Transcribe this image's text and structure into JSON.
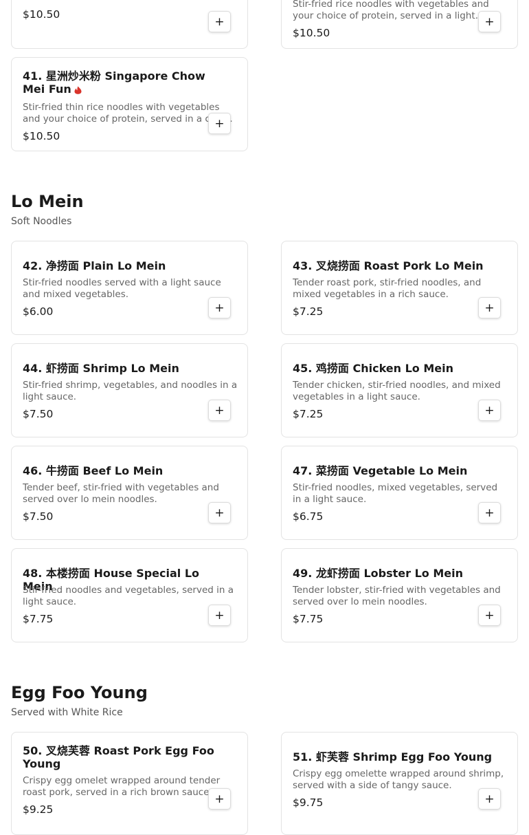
{
  "colors": {
    "spicy": "#d9342b",
    "card_border": "#e3e3e3",
    "description": "#666666"
  },
  "add_button_label": "+",
  "top_items": [
    {
      "price": "$10.50"
    },
    {
      "description": "Stir-fried rice noodles with vegetables and your choice of protein, served in a light sauce.",
      "price": "$10.50"
    },
    {
      "title": "41. 星洲炒米粉 Singapore Chow Mei Fun",
      "spicy": true,
      "spicy_icon": "chili-flame-icon",
      "description": "Stir-fried thin rice noodles with vegetables and your choice of protein, served in a curry sauce.",
      "price": "$10.50"
    }
  ],
  "sections": [
    {
      "title": "Lo Mein",
      "subtitle": "Soft Noodles",
      "items": [
        {
          "title": "42. 净捞面 Plain Lo Mein",
          "description": "Stir-fried noodles served with a light sauce and mixed vegetables.",
          "price": "$6.00"
        },
        {
          "title": "43. 叉烧捞面 Roast Pork Lo Mein",
          "description": "Tender roast pork, stir-fried noodles, and mixed vegetables in a rich sauce.",
          "price": "$7.25"
        },
        {
          "title": "44. 虾捞面 Shrimp Lo Mein",
          "description": "Stir-fried shrimp, vegetables, and noodles in a light sauce.",
          "price": "$7.50"
        },
        {
          "title": "45. 鸡捞面 Chicken Lo Mein",
          "description": "Tender chicken, stir-fried noodles, and mixed vegetables in a light sauce.",
          "price": "$7.25"
        },
        {
          "title": "46. 牛捞面 Beef Lo Mein",
          "description": "Tender beef, stir-fried with vegetables and served over lo mein noodles.",
          "price": "$7.50"
        },
        {
          "title": "47. 菜捞面 Vegetable Lo Mein",
          "description": "Stir-fried noodles, mixed vegetables, served in a light sauce.",
          "price": "$6.75"
        },
        {
          "title": "48. 本楼捞面 House Special Lo Mein",
          "description": "Stir-fried noodles and vegetables, served in a light sauce.",
          "price": "$7.75"
        },
        {
          "title": "49. 龙虾捞面 Lobster Lo Mein",
          "description": "Tender lobster, stir-fried with vegetables and served over lo mein noodles.",
          "price": "$7.75"
        }
      ]
    },
    {
      "title": "Egg Foo Young",
      "subtitle": "Served with White Rice",
      "items": [
        {
          "title": "50. 叉烧芙蓉 Roast Pork Egg Foo Young",
          "description": "Crispy egg omelet wrapped around tender roast pork, served in a rich brown sauce.",
          "price": "$9.25"
        },
        {
          "title": "51. 虾芙蓉 Shrimp Egg Foo Young",
          "description": "Crispy egg omelette wrapped around shrimp, served with a side of tangy sauce.",
          "price": "$9.75"
        }
      ]
    }
  ]
}
